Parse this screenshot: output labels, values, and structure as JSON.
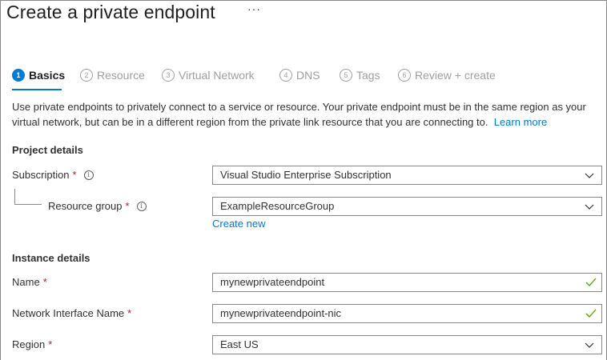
{
  "page": {
    "title": "Create a private endpoint",
    "more_label": "···"
  },
  "tabs": [
    {
      "num": "1",
      "label": "Basics"
    },
    {
      "num": "2",
      "label": "Resource"
    },
    {
      "num": "3",
      "label": "Virtual Network"
    },
    {
      "num": "4",
      "label": "DNS"
    },
    {
      "num": "5",
      "label": "Tags"
    },
    {
      "num": "6",
      "label": "Review + create"
    }
  ],
  "intro": {
    "text": "Use private endpoints to privately connect to a service or resource. Your private endpoint must be in the same region as your virtual network, but can be in a different region from the private link resource that you are connecting to.",
    "learn_more": "Learn more"
  },
  "project": {
    "heading": "Project details",
    "subscription_label": "Subscription",
    "subscription_value": "Visual Studio Enterprise Subscription",
    "resource_group_label": "Resource group",
    "resource_group_value": "ExampleResourceGroup",
    "create_new": "Create new"
  },
  "instance": {
    "heading": "Instance details",
    "name_label": "Name",
    "name_value": "mynewprivateendpoint",
    "nic_label": "Network Interface Name",
    "nic_value": "mynewprivateendpoint-nic",
    "region_label": "Region",
    "region_value": "East US"
  },
  "required_marker": "*",
  "info_glyph": "i",
  "colors": {
    "accent": "#0078d4",
    "required": "#a4262c",
    "valid_check": "#57a300"
  }
}
